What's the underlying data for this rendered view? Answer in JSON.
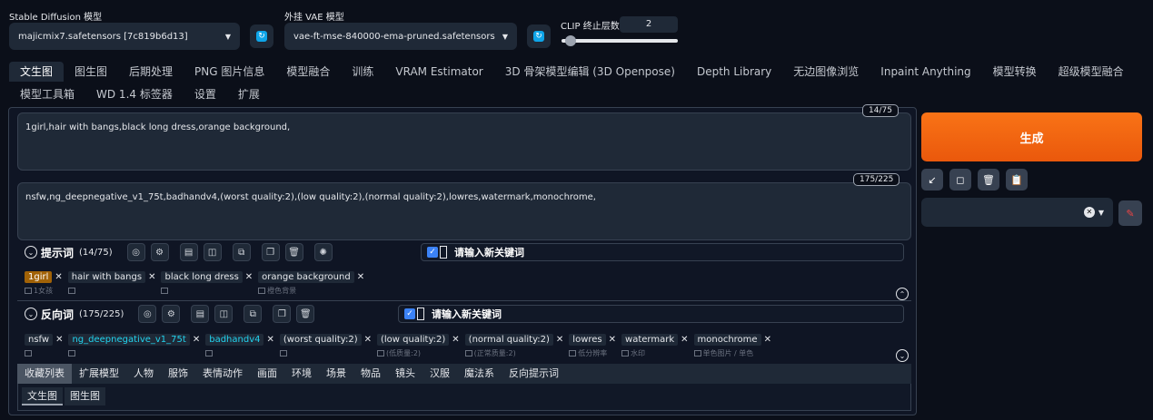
{
  "top": {
    "sd_label": "Stable Diffusion 模型",
    "sd_value": "majicmix7.safetensors [7c819b6d13]",
    "vae_label": "外挂 VAE 模型",
    "vae_value": "vae-ft-mse-840000-ema-pruned.safetensors",
    "clip_label": "CLIP 终止层数",
    "clip_value": "2",
    "clip_slider_fraction": 0.08
  },
  "tabs": [
    "文生图",
    "图生图",
    "后期处理",
    "PNG 图片信息",
    "模型融合",
    "训练",
    "VRAM Estimator",
    "3D 骨架模型编辑 (3D Openpose)",
    "Depth Library",
    "无边图像浏览",
    "Inpaint Anything",
    "模型转换",
    "超级模型融合",
    "模型工具箱",
    "WD 1.4 标签器",
    "设置",
    "扩展"
  ],
  "prompt": {
    "text": "1girl,hair with bangs,black long dress,orange background,",
    "count": "14/75"
  },
  "negative": {
    "text": "nsfw,ng_deepnegative_v1_75t,badhandv4,(worst quality:2),(low quality:2),(normal quality:2),lowres,watermark,monochrome,",
    "count": "175/225"
  },
  "generate_label": "生成",
  "tool_icons": [
    "↙",
    "◻",
    "🗑",
    "📋"
  ],
  "styles_clear": "✕",
  "prompt_section": {
    "title": "提示词",
    "count": "(14/75)",
    "kw_placeholder": "请输入新关键词",
    "chips": [
      {
        "t": "1girl",
        "sub": "1女孩",
        "hl": true
      },
      {
        "t": "hair with bangs",
        "sub": ""
      },
      {
        "t": "black long dress",
        "sub": ""
      },
      {
        "t": "orange background",
        "sub": "橙色背景"
      }
    ]
  },
  "neg_section": {
    "title": "反向词",
    "count": "(175/225)",
    "kw_placeholder": "请输入新关键词",
    "chips": [
      {
        "t": "nsfw",
        "sub": ""
      },
      {
        "t": "ng_deepnegative_v1_75t",
        "sub": "",
        "teal": true
      },
      {
        "t": "badhandv4",
        "sub": "",
        "teal": true
      },
      {
        "t": "(worst quality:2)",
        "sub": ""
      },
      {
        "t": "(low quality:2)",
        "sub": "(低质量:2)"
      },
      {
        "t": "(normal quality:2)",
        "sub": "(正常质量:2)"
      },
      {
        "t": "lowres",
        "sub": "低分辨率"
      },
      {
        "t": "watermark",
        "sub": "水印"
      },
      {
        "t": "monochrome",
        "sub": "单色图片 / 单色"
      }
    ]
  },
  "categories": [
    "收藏列表",
    "扩展模型",
    "人物",
    "服饰",
    "表情动作",
    "画面",
    "环境",
    "场景",
    "物品",
    "镜头",
    "汉服",
    "魔法系",
    "反向提示词"
  ],
  "subtabs": [
    "文生图",
    "图生图"
  ]
}
